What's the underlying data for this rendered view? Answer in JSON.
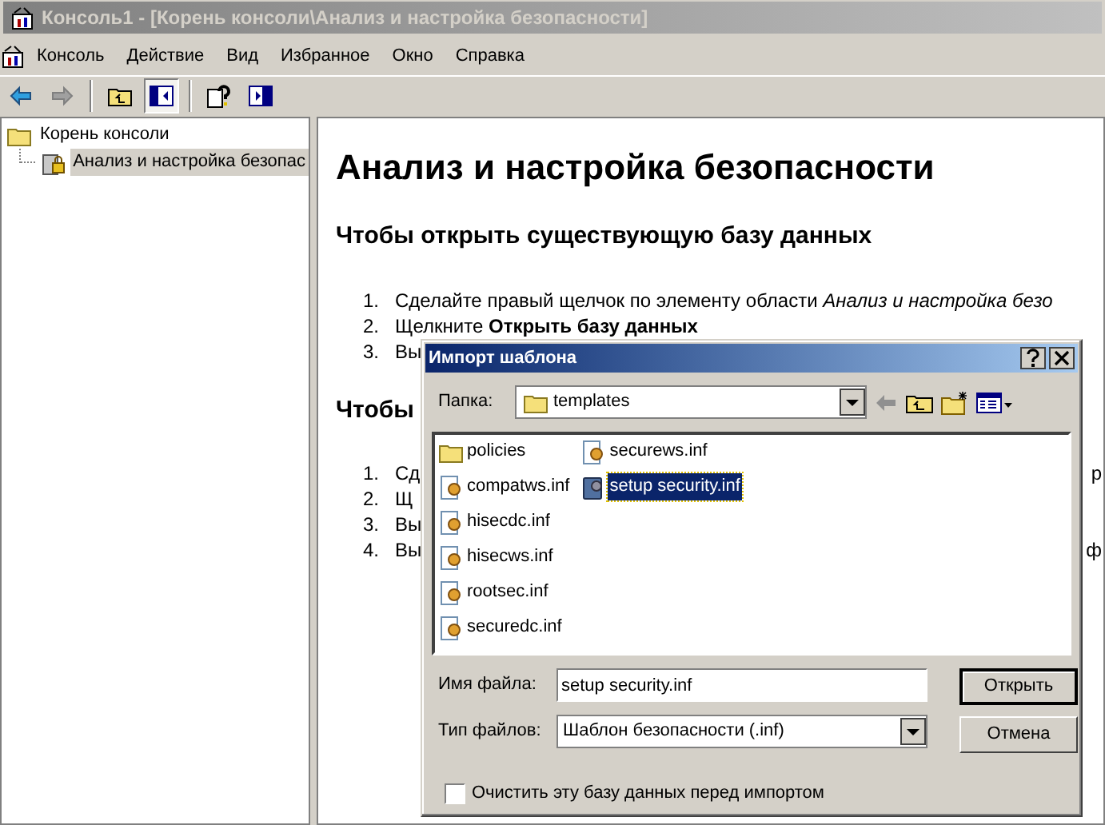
{
  "window": {
    "title": "Консоль1 - [Корень консоли\\Анализ и настройка безопасности]"
  },
  "menu": [
    "Консоль",
    "Действие",
    "Вид",
    "Избранное",
    "Окно",
    "Справка"
  ],
  "toolbar": [
    {
      "kind": "back",
      "pressed": false
    },
    {
      "kind": "forward",
      "pressed": false
    },
    {
      "kind": "sep"
    },
    {
      "kind": "up",
      "pressed": false
    },
    {
      "kind": "tree",
      "pressed": true
    },
    {
      "kind": "sep"
    },
    {
      "kind": "help",
      "pressed": false
    },
    {
      "kind": "pane",
      "pressed": false
    }
  ],
  "tree": [
    {
      "label": "Корень консоли",
      "kind": "folder",
      "selected": false,
      "children": [
        {
          "label": "Анализ и настройка безопас",
          "kind": "lock",
          "selected": true
        }
      ]
    }
  ],
  "content": {
    "title": "Анализ и настройка безопасности",
    "sections": [
      {
        "heading": "Чтобы открыть существующую базу данных",
        "steps": [
          {
            "number": "1.",
            "text": "Сделайте правый щелчок по элементу области *Анализ и настройка безо*"
          },
          {
            "number": "2.",
            "text": "Щелкните **Открыть базу данных**"
          },
          {
            "number": "3.",
            "text": "Вы"
          }
        ]
      },
      {
        "heading": "Чтобы",
        "steps": [
          {
            "number": "1.",
            "text": "Сд",
            "tail": "р"
          },
          {
            "number": "2.",
            "text": "Щ"
          },
          {
            "number": "3.",
            "text": "Вы"
          },
          {
            "number": "4.",
            "text": "Вы",
            "tail": "ф"
          }
        ]
      }
    ]
  },
  "dialog": {
    "title": "Импорт шаблона",
    "folder_label": "Папка:",
    "folder": "templates",
    "files": [
      {
        "name": "policies",
        "kind": "folder",
        "selected": false
      },
      {
        "name": "compatws.inf",
        "kind": "inf",
        "selected": false
      },
      {
        "name": "hisecdc.inf",
        "kind": "inf",
        "selected": false
      },
      {
        "name": "hisecws.inf",
        "kind": "inf",
        "selected": false
      },
      {
        "name": "rootsec.inf",
        "kind": "inf",
        "selected": false
      },
      {
        "name": "securedc.inf",
        "kind": "inf",
        "selected": false
      },
      {
        "name": "securews.inf",
        "kind": "inf",
        "selected": false
      },
      {
        "name": "setup security.inf",
        "kind": "db",
        "selected": true
      }
    ],
    "filename_label": "Имя файла:",
    "filename": "setup security.inf",
    "filetype_label": "Тип файлов:",
    "filetype": "Шаблон безопасности (.inf)",
    "buttons": [
      {
        "label": "Открыть",
        "default": true
      },
      {
        "label": "Отмена",
        "default": false
      }
    ],
    "checkbox": {
      "label": "Очистить эту базу данных перед импортом",
      "checked": false
    }
  }
}
